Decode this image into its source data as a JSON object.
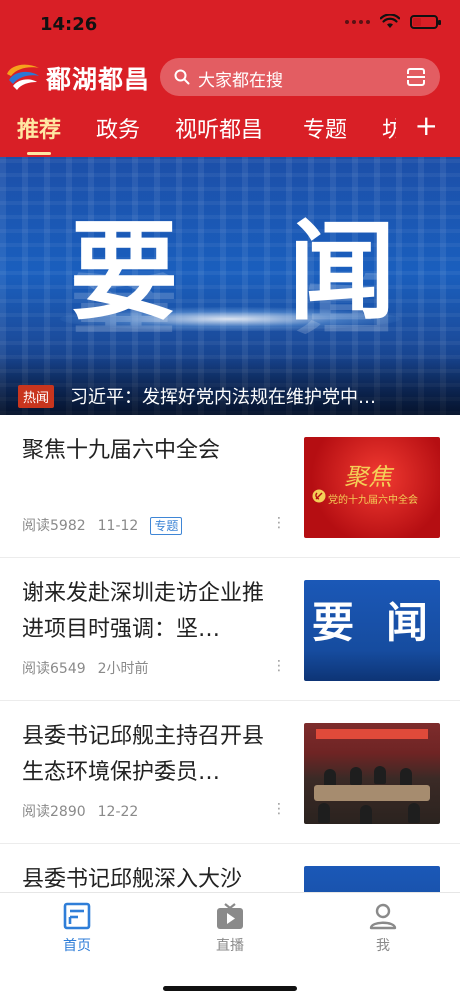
{
  "status_bar": {
    "time": "14:26"
  },
  "header": {
    "brand_name": "鄱湖都昌",
    "search_placeholder": "大家都在搜",
    "tabs": [
      {
        "label": "推荐",
        "active": true
      },
      {
        "label": "政务",
        "active": false
      },
      {
        "label": "视听都昌",
        "active": false
      },
      {
        "label": "专题",
        "active": false
      },
      {
        "label": "坊",
        "active": false
      }
    ],
    "add_tab": "+"
  },
  "banner": {
    "word_left": "要",
    "word_right": "闻",
    "tag": "热闻",
    "caption": "习近平：发挥好党内法规在维护党中…"
  },
  "news": [
    {
      "title": "聚焦十九届六中全会",
      "reads": "阅读5982",
      "time": "11-12",
      "badge": "专题",
      "thumb": {
        "calligraphy": "聚焦",
        "subtitle": "党的十九届六中全会"
      }
    },
    {
      "title": "谢来发赴深圳走访企业推进项目时强调：坚…",
      "reads": "阅读6549",
      "time": "2小时前",
      "thumb": {
        "word_left": "要",
        "word_right": "闻"
      }
    },
    {
      "title": "县委书记邱舰主持召开县生态环境保护委员…",
      "reads": "阅读2890",
      "time": "12-22"
    },
    {
      "title": "县委书记邱舰深入大沙"
    }
  ],
  "more_glyph": "⋮",
  "bottom_nav": [
    {
      "label": "首页",
      "active": true
    },
    {
      "label": "直播",
      "active": false
    },
    {
      "label": "我",
      "active": false
    }
  ],
  "colors": {
    "header_red": "#d91f26",
    "active_tab": "#ffe7a3",
    "accent_blue": "#2f7ed8"
  }
}
